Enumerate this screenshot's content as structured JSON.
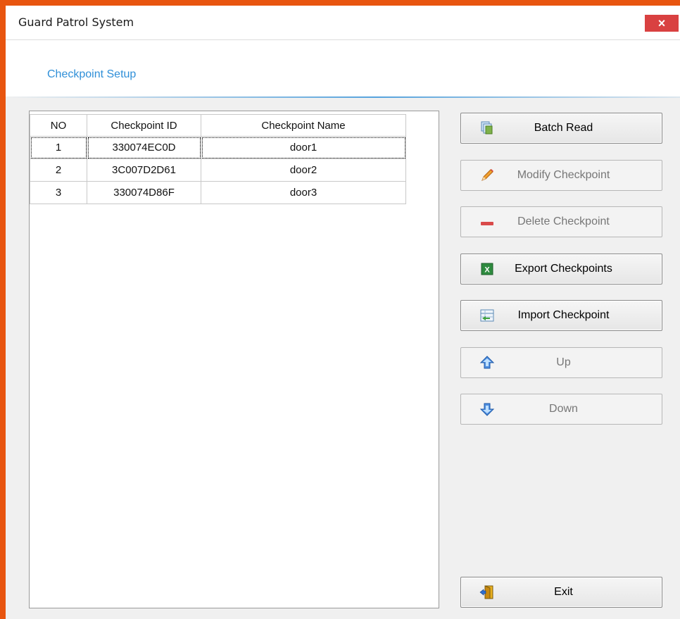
{
  "window": {
    "title": "Guard Patrol System",
    "close_glyph": "×"
  },
  "header": {
    "title": "Checkpoint Setup"
  },
  "table": {
    "columns": [
      "NO",
      "Checkpoint ID",
      "Checkpoint Name"
    ],
    "rows": [
      [
        "1",
        "330074EC0D",
        "door1"
      ],
      [
        "2",
        "3C007D2D61",
        "door2"
      ],
      [
        "3",
        "330074D86F",
        "door3"
      ]
    ],
    "selected_row": 0
  },
  "buttons": {
    "batch_read": {
      "label": "Batch Read",
      "icon": "stack-icon",
      "enabled": true
    },
    "modify": {
      "label": "Modify Checkpoint",
      "icon": "pencil-icon",
      "enabled": false
    },
    "delete": {
      "label": "Delete Checkpoint",
      "icon": "minus-icon",
      "enabled": false
    },
    "export": {
      "label": "Export Checkpoints",
      "icon": "excel-icon",
      "enabled": true
    },
    "import": {
      "label": "Import Checkpoint",
      "icon": "import-sheet-icon",
      "enabled": true
    },
    "up": {
      "label": "Up",
      "icon": "arrow-up-icon",
      "enabled": false
    },
    "down": {
      "label": "Down",
      "icon": "arrow-down-icon",
      "enabled": false
    },
    "exit": {
      "label": "Exit",
      "icon": "exit-door-icon",
      "enabled": true
    }
  },
  "colors": {
    "accent": "#2f8fd8",
    "frame": "#e8550f",
    "close": "#d94141"
  }
}
